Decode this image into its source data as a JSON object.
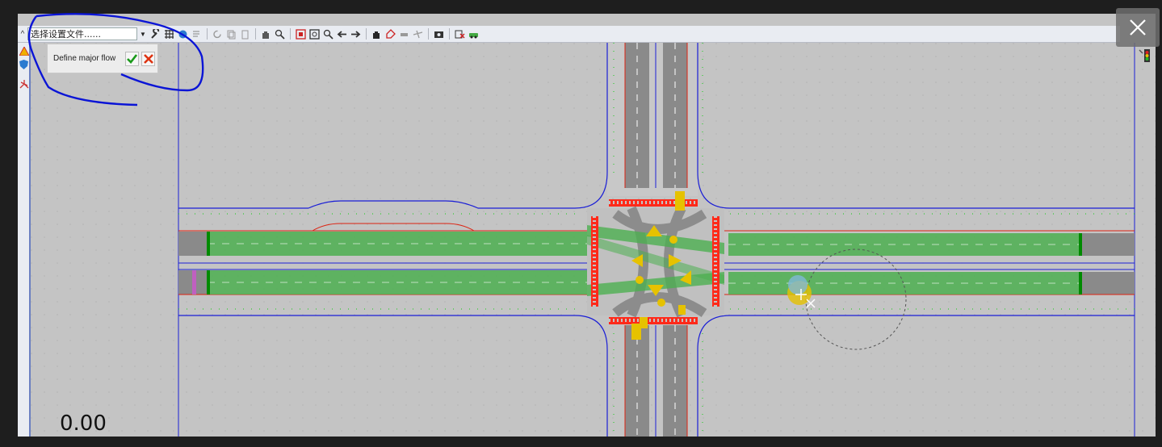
{
  "toolbar": {
    "profile_select_value": "选择设置文件......",
    "icons": [
      "wrench-icon",
      "grid-icon",
      "globe-icon",
      "list-icon",
      "rotate-icon",
      "copy-icon",
      "paste-icon",
      "pan-icon",
      "zoom-window-icon",
      "zoom-fit-icon",
      "zoom-extents-icon",
      "zoom-icon",
      "arrow-left-icon",
      "arrow-right-icon",
      "hand-icon",
      "tag-icon",
      "vehicle-icon",
      "aircraft-icon",
      "camera-icon",
      "delete-icon",
      "car-icon"
    ]
  },
  "popup": {
    "label": "Define major flow",
    "confirm_icon": "check-icon",
    "cancel_icon": "cross-icon"
  },
  "left_panel_icons": [
    "warning-icon",
    "shield-icon",
    "junction-icon"
  ],
  "readout": "0.00",
  "colors": {
    "background": "#c4c4c4",
    "road_edge": "#1b1fd6",
    "major_flow": "#4caf50",
    "stop_bar": "#008a00",
    "crossing": "#ff2a1a",
    "conflict": "#e6c200",
    "annotation": "#0a14d6"
  }
}
